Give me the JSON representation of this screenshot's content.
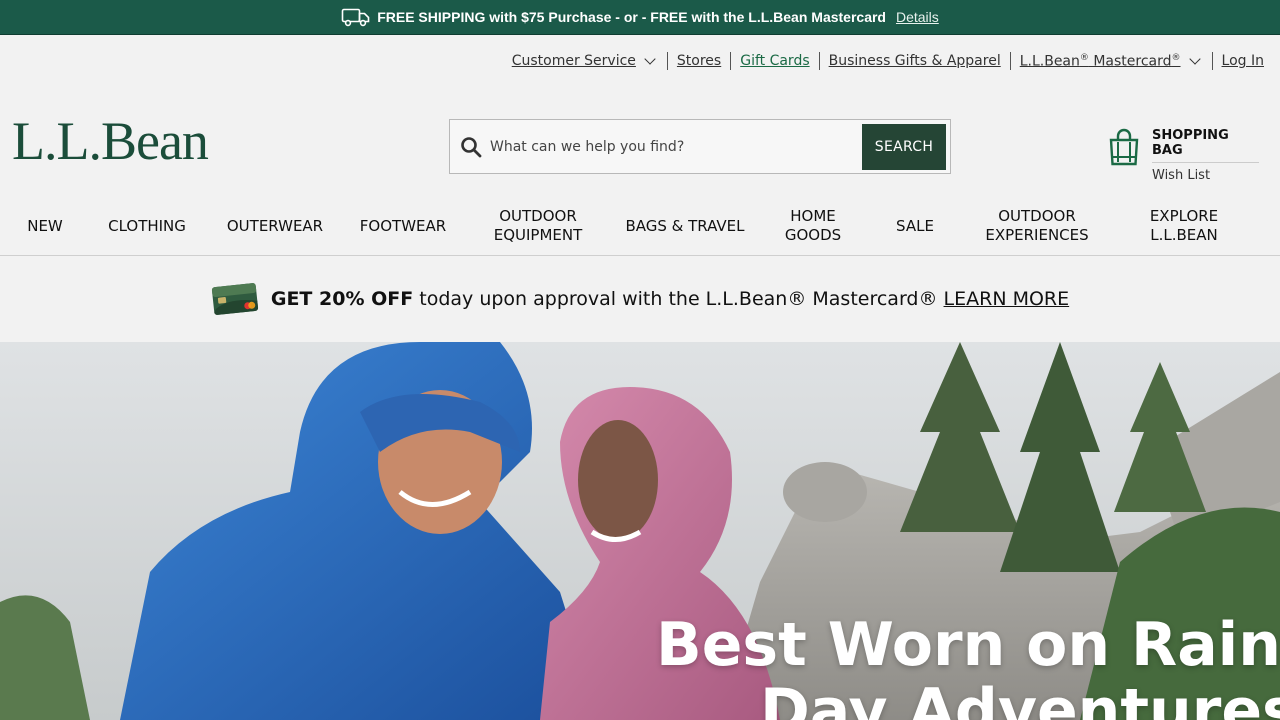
{
  "promo_bar": {
    "text": "FREE SHIPPING with $75 Purchase - or - FREE with the L.L.Bean Mastercard",
    "details_label": "Details",
    "truck_icon": "delivery-truck-icon"
  },
  "utility_nav": {
    "customer_service": "Customer Service",
    "stores": "Stores",
    "gift_cards": "Gift Cards",
    "business_gifts": "Business Gifts & Apparel",
    "mastercard": "L.L.Bean",
    "mastercard_suffix": " Mastercard",
    "login": "Log In"
  },
  "logo": {
    "text": "L.L.Bean"
  },
  "search": {
    "placeholder": "What can we help you find?",
    "button_label": "SEARCH"
  },
  "bag": {
    "title": "SHOPPING BAG",
    "wish_list": "Wish List"
  },
  "main_nav": {
    "items": [
      {
        "line1": "NEW",
        "line2": ""
      },
      {
        "line1": "CLOTHING",
        "line2": ""
      },
      {
        "line1": "OUTERWEAR",
        "line2": ""
      },
      {
        "line1": "FOOTWEAR",
        "line2": ""
      },
      {
        "line1": "OUTDOOR",
        "line2": "EQUIPMENT"
      },
      {
        "line1": "BAGS & TRAVEL",
        "line2": ""
      },
      {
        "line1": "HOME",
        "line2": "GOODS"
      },
      {
        "line1": "SALE",
        "line2": ""
      },
      {
        "line1": "OUTDOOR",
        "line2": "EXPERIENCES"
      },
      {
        "line1": "EXPLORE",
        "line2": "L.L.BEAN"
      }
    ]
  },
  "card_promo": {
    "bold": "GET 20% OFF",
    "text": " today upon approval with the L.L.Bean® Mastercard® ",
    "learn_more": "LEARN MORE"
  },
  "hero": {
    "headline_line1": "Best Worn on Rainy",
    "headline_line2": "Day Adventures"
  },
  "colors": {
    "brand_green": "#1b4d3a",
    "promo_bar_bg": "#1b5a49",
    "search_button_bg": "#254535",
    "gift_card_link": "#1b6a45"
  }
}
